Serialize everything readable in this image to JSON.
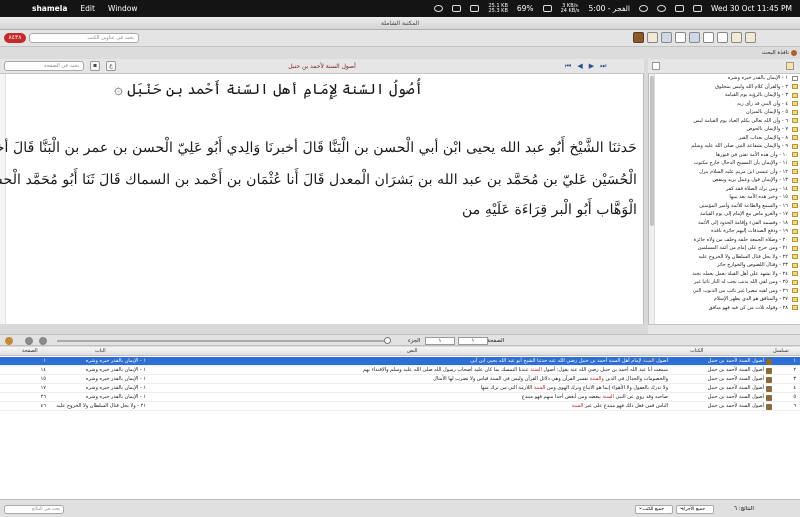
{
  "menubar": {
    "app_name": "shamela",
    "menus": [
      "Edit",
      "Window"
    ],
    "status": {
      "net_up": "25.1 KB",
      "net_down": "25.3 KB",
      "battery": "69%",
      "speed_up": "3 KB/s",
      "speed_down": "24 KB/s",
      "prayer": "الفجر - 5:00",
      "datetime": "Wed 30 Oct  11:45 PM"
    }
  },
  "window": {
    "title": "المكتبة الشاملة"
  },
  "toolbar": {
    "counter": "٨٤٣٨",
    "search_books_placeholder": "بحث في عناوين الكتب"
  },
  "side_tab": {
    "label": "نافذة البحث"
  },
  "reader_bar": {
    "search_page_placeholder": "بحث في الصفحة",
    "book_title": "أصول السنة لأحمد بن حنبل"
  },
  "reader": {
    "heading": "أُصُولُ السّنة لِإِمَامِ أهل السّنة أَحْمد بن حَنْبَل ۞",
    "lines": [
      "حَدثنَا الشَّيْخ أَبُو عبد الله يحيى ابْن أبي الْحسن بن الْبَنَّا قَالَ أخبرنَا وَالِدي أَبُو عَلِيّ الْحسن بن عمر بن الْبَنَّا قَالَ أخبرنَا أَبُو",
      "الْحُسَيْن عَليّ بن مُحَمَّد بن عبد الله بن بَشرَان الْمعدل قَالَ أَنا عُثْمَان بن أَحْمد بن السماك قَالَ ثَنَا أَبُو مُحَمَّد الْحسن بن عبد",
      "الْوَهَّاب أَبُو الْبر قِرَاءَة عَلَيْهِ من"
    ]
  },
  "tree": {
    "items": [
      "١ - الإيمان بالقدر خيره وشره",
      "٢ - والقرآن كلام الله وليس بمخلوق",
      "٣ - والإيمان بالرؤية يوم القيامة",
      "٤ - وأن النبي قد رأى ربه",
      "٥ - والإيمان بالميزان",
      "٦ - وأن الله تعالى يكلم العباد يوم القيامة ليس",
      "٧ - والإيمان بالحوض",
      "٨ - والإيمان بعذاب القبر",
      "٩ - والإيمان بشفاعة النبي صلى الله عليه وسلم",
      "١٠ - وأن هذه الأمة تفتن في قبورها",
      "١١ - والإيمان بأن المسيح الدجال خارج مكتوب",
      "١٢ - وأن عيسى ابن مريم عليه السلام ينزل",
      "١٣ - والإيمان قول وعمل يزيد وينقص",
      "١٤ - ومن ترك الصلاة فقد كفر",
      "١٥ - وخير هذه الأمة بعد نبيها",
      "١٦ - والسمع والطاعة للأئمة وأمير المؤمنين",
      "١٧ - والغزو ماض مع الإمام إلى يوم القيامة",
      "١٨ - وقسمة الفيء وإقامة الحدود إلى الأئمة",
      "١٩ - ودفع الصدقات إليهم جائزة نافذة",
      "٢٠ - وصلاة الجمعة خلفه وخلف من ولاه جائزة",
      "٢١ - ومن خرج على إمام من أئمة المسلمين",
      "٢٢ - ولا يحل قتال السلطان ولا الخروج عليه",
      "٢٣ - وقتال اللصوص والخوارج جائز",
      "٢٤ - ولا نشهد على أهل القبلة بعمل يعمله بجنة",
      "٢٥ - ومن لقي الله بذنب يجب له النار تائبا غير",
      "٢٦ - ومن لقيه مصرا غير تائب من الذنوب التي",
      "٢٧ - والمنافق هو الذي يظهر الإسلام",
      "٢٨ - وقوله ثلاث من كن فيه فهو منافق"
    ]
  },
  "page_nav": {
    "page_label": "الصفحة",
    "page_value": "١",
    "part_label": "الجزء",
    "part_value": "١"
  },
  "results": {
    "headers": {
      "index": "تسلسل",
      "book": "الكتاب",
      "text": "النص",
      "chapter": "الباب",
      "page": "الصفحة"
    },
    "rows": [
      {
        "index": "١",
        "book": "أصول السنة لأحمد بن حنبل",
        "text_before": "أصول ",
        "text_hl": "السنة",
        "text_after": " لإمام أهل السنة أحمد بن حنبل رضي الله عنه حدثنا الشيخ أبو عبد الله يحيى ابن أبي",
        "chapter": "١ - الإيمان بالقدر خيره وشره",
        "page": "١"
      },
      {
        "index": "٢",
        "book": "أصول السنة لأحمد بن حنبل",
        "text_before": "سمعت أبا عبد الله أحمد بن حنبل رضي الله عنه يقول: أصول ",
        "text_hl": "السنة",
        "text_after": " عندنا التمسك بما كان عليه أصحاب رسول الله صلى الله عليه وسلم والاقتداء بهم",
        "chapter": "١ - الإيمان بالقدر خيره وشره",
        "page": "١٤"
      },
      {
        "index": "٣",
        "book": "أصول السنة لأحمد بن حنبل",
        "text_before": "والخصومات والجدال في الدين ",
        "text_hl": "والسنة",
        "text_after": " تفسر القرآن وهي دلائل القرآن وليس في السنة قياس ولا تضرب لها الأمثال",
        "chapter": "١ - الإيمان بالقدر خيره وشره",
        "page": "١٥"
      },
      {
        "index": "٤",
        "book": "أصول السنة لأحمد بن حنبل",
        "text_before": "ولا تدرك بالعقول ولا الأهواء إنما هو الاتباع وترك الهوى ومن ",
        "text_hl": "السنة",
        "text_after": " اللازمة التي من ترك منها",
        "chapter": "١ - الإيمان بالقدر خيره وشره",
        "page": "١٧"
      },
      {
        "index": "٥",
        "book": "أصول السنة لأحمد بن حنبل",
        "text_before": "صاحبه وقد روي عن النبي ",
        "text_hl": "السنة",
        "text_after": " يبغضه ومن أبغض أحدا منهم فهو مبتدع",
        "chapter": "١ - الإيمان بالقدر خيره وشره",
        "page": "٢٦"
      },
      {
        "index": "٦",
        "book": "أصول السنة لأحمد بن حنبل",
        "text_before": "الناس فمن فعل ذلك فهو مبتدع على غير ",
        "text_hl": "السنة",
        "text_after": "",
        "chapter": "٢١ - ولا يحل قتال السلطان ولا الخروج عليه",
        "page": "٤٦"
      }
    ]
  },
  "status": {
    "filter_placeholder": "بحث في النتائج",
    "select1": "جميع الكتب",
    "select2": "جميع الأجزاء",
    "count": "النتائج: ٦"
  }
}
